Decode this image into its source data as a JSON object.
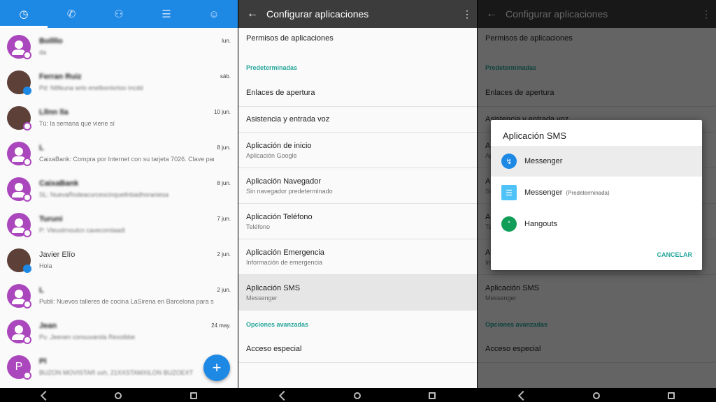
{
  "contacts_panel": {
    "tabs": [
      "recent-icon",
      "phone-icon",
      "contacts-icon",
      "list-icon",
      "account-icon"
    ],
    "conversations": [
      {
        "name": "Bollllo",
        "preview": "da",
        "date": "lun.",
        "avatar": "person",
        "badge": "messenger"
      },
      {
        "name": "Ferran Ruiz",
        "preview": "Pd: Ntltkuna wrlo enelbonlxrtoo incdd",
        "date": "sáb.",
        "avatar": "photo",
        "badge": "blue"
      },
      {
        "name": "Lllnn lla",
        "preview": "Tú: la semana que viene sí",
        "date": "10 jun.",
        "avatar": "photo",
        "badge": "messenger"
      },
      {
        "name": "L",
        "preview": "CaixaBank: Compra por Internet con su tarjeta 7026. Clave para",
        "date": "8 jun.",
        "avatar": "person",
        "badge": "messenger"
      },
      {
        "name": "CaixaBank",
        "preview": "SL: NuevaRodeacurcescinquellnbadhoraniesa",
        "date": "8 jun.",
        "avatar": "person",
        "badge": "messenger"
      },
      {
        "name": "Turuni",
        "preview": "P: Vleuslrnoulcn cavecomlaadl",
        "date": "7 jun.",
        "avatar": "person",
        "badge": "messenger"
      },
      {
        "name": "Javier Elío",
        "preview": "Hola",
        "date": "2 jun.",
        "avatar": "photo",
        "badge": "blue"
      },
      {
        "name": "L",
        "preview": "Publi: Nuevos talleres de cocina LaSirena en Barcelona para s",
        "date": "2 jun.",
        "avatar": "person",
        "badge": "messenger"
      },
      {
        "name": "Jean",
        "preview": "Pu .Jeenen consuvarola Rexoibbe",
        "date": "24 may.",
        "avatar": "person",
        "badge": "messenger"
      },
      {
        "name": "Pl",
        "preview": "BUZON MOVISTAR xxh, 21XXSTAMXILON BUZOEXT",
        "date": "",
        "avatar": "P",
        "badge": "messenger"
      }
    ],
    "fab_label": "+"
  },
  "settings_panel": {
    "back_icon": "←",
    "title": "Configurar aplicaciones",
    "more_icon": "⋮",
    "items": {
      "permisos": {
        "title": "Permisos de aplicaciones"
      },
      "header_pred": "Predeterminadas",
      "enlaces": {
        "title": "Enlaces de apertura"
      },
      "asistencia": {
        "title": "Asistencia y entrada voz"
      },
      "inicio": {
        "title": "Aplicación de inicio",
        "subtitle": "Aplicación Google"
      },
      "navegador": {
        "title": "Aplicación Navegador",
        "subtitle": "Sin navegador predeterminado"
      },
      "telefono": {
        "title": "Aplicación Teléfono",
        "subtitle": "Teléfono"
      },
      "emergencia": {
        "title": "Aplicación Emergencia",
        "subtitle": "Información de emergencia"
      },
      "sms": {
        "title": "Aplicación SMS",
        "subtitle": "Messenger"
      },
      "header_adv": "Opciones avanzadas",
      "acceso": {
        "title": "Acceso especial"
      }
    }
  },
  "dialog": {
    "title": "Aplicación SMS",
    "options": [
      {
        "label": "Messenger",
        "desc": "",
        "icon": "messenger-icon"
      },
      {
        "label": "Messenger",
        "desc": "(Predeterminada)",
        "icon": "sms-icon"
      },
      {
        "label": "Hangouts",
        "desc": "",
        "icon": "hangouts-icon"
      }
    ],
    "cancel": "CANCELAR"
  },
  "colors": {
    "primary_blue": "#1e88e5",
    "avatar_purple": "#ab47bc",
    "teal": "#26a69a",
    "appbar": "#3c3c3c"
  }
}
